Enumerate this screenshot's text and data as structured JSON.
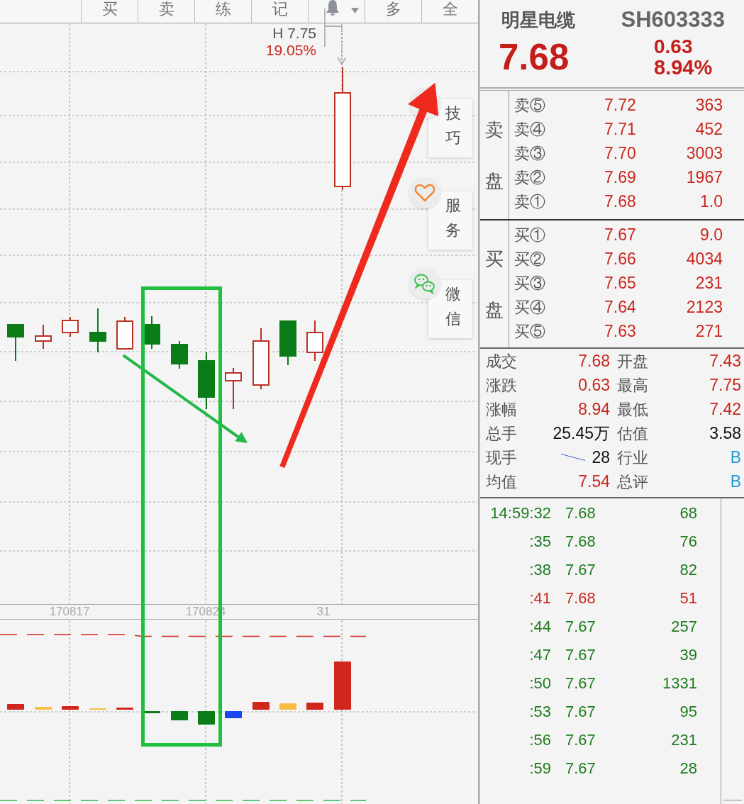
{
  "toolbar": {
    "tabs": [
      {
        "kind": "text",
        "label": "买"
      },
      {
        "kind": "text",
        "label": "卖"
      },
      {
        "kind": "text",
        "label": "练"
      },
      {
        "kind": "text",
        "label": "记"
      },
      {
        "kind": "alert"
      },
      {
        "kind": "text",
        "label": "多"
      },
      {
        "kind": "text",
        "label": "全"
      }
    ]
  },
  "chart": {
    "high_marker": {
      "label": "H 7.75",
      "change": "19.05%"
    },
    "x_labels": [
      "170817",
      "170824",
      "31"
    ]
  },
  "side_buttons": [
    {
      "kind": "tips",
      "label": "技巧"
    },
    {
      "kind": "service",
      "label": "服务"
    },
    {
      "kind": "wechat",
      "label": "微信"
    }
  ],
  "quote": {
    "name": "明星电缆",
    "code": "SH603333",
    "price": "7.68",
    "change": "0.63",
    "change_percent": "8.94%"
  },
  "order_book": {
    "asks": {
      "label": "卖盘",
      "rows": [
        {
          "label": "卖⑤",
          "price": "7.72",
          "volume": "363"
        },
        {
          "label": "卖④",
          "price": "7.71",
          "volume": "452"
        },
        {
          "label": "卖③",
          "price": "7.70",
          "volume": "3003"
        },
        {
          "label": "卖②",
          "price": "7.69",
          "volume": "1967"
        },
        {
          "label": "卖①",
          "price": "7.68",
          "volume": "1.0"
        }
      ]
    },
    "bids": {
      "label": "买盘",
      "rows": [
        {
          "label": "买①",
          "price": "7.67",
          "volume": "9.0"
        },
        {
          "label": "买②",
          "price": "7.66",
          "volume": "4034"
        },
        {
          "label": "买③",
          "price": "7.65",
          "volume": "231"
        },
        {
          "label": "买④",
          "price": "7.64",
          "volume": "2123"
        },
        {
          "label": "买⑤",
          "price": "7.63",
          "volume": "271"
        }
      ]
    }
  },
  "stats": [
    {
      "label": "成交",
      "value": "7.68",
      "color": "#c8281e"
    },
    {
      "label": "开盘",
      "value": "7.43",
      "color": "#c8281e"
    },
    {
      "label": "涨跌",
      "value": "0.63",
      "color": "#c8281e"
    },
    {
      "label": "最高",
      "value": "7.75",
      "color": "#c8281e"
    },
    {
      "label": "涨幅",
      "value": "8.94",
      "color": "#c8281e"
    },
    {
      "label": "最低",
      "value": "7.42",
      "color": "#c8281e"
    },
    {
      "label": "总手",
      "value": "25.45万",
      "color": "#111111"
    },
    {
      "label": "估值",
      "value": "3.58",
      "color": "#111111"
    },
    {
      "label": "现手",
      "value": "28",
      "color": "#111111",
      "sparkline": true
    },
    {
      "label": "行业",
      "value": "B",
      "color": "#1f9ad6"
    },
    {
      "label": "均值",
      "value": "7.54",
      "color": "#c8281e"
    },
    {
      "label": "总评",
      "value": "B",
      "color": "#1f9ad6"
    }
  ],
  "ticks": [
    {
      "time": "14:59:32",
      "price": "7.68",
      "volume": "68",
      "color": "#1e7b1e"
    },
    {
      "time": ":35",
      "price": "7.68",
      "volume": "76",
      "color": "#1e7b1e"
    },
    {
      "time": ":38",
      "price": "7.67",
      "volume": "82",
      "color": "#1e7b1e"
    },
    {
      "time": ":41",
      "price": "7.68",
      "volume": "51",
      "color": "#c8281e"
    },
    {
      "time": ":44",
      "price": "7.67",
      "volume": "257",
      "color": "#1e7b1e"
    },
    {
      "time": ":47",
      "price": "7.67",
      "volume": "39",
      "color": "#1e7b1e"
    },
    {
      "time": ":50",
      "price": "7.67",
      "volume": "1331",
      "color": "#1e7b1e"
    },
    {
      "time": ":53",
      "price": "7.67",
      "volume": "95",
      "color": "#1e7b1e"
    },
    {
      "time": ":56",
      "price": "7.67",
      "volume": "231",
      "color": "#1e7b1e"
    },
    {
      "time": ":59",
      "price": "7.67",
      "volume": "28",
      "color": "#1e7b1e"
    }
  ]
}
